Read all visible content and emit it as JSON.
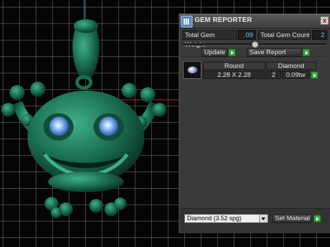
{
  "viewport": {
    "accent_colors": {
      "model": "#1f7a5c",
      "eyes": "#7ab8ff",
      "axis_x": "#b02020",
      "axis_y": "#2aa6c8"
    }
  },
  "panel": {
    "title": "GEM REPORTER",
    "close_label": "x",
    "total_gem_weight_label": "Total Gem Weight",
    "total_gem_weight_value": ".09",
    "total_gem_count_label": "Total Gem Count",
    "total_gem_count_value": "2",
    "update_label": "Update",
    "save_report_label": "Save Report",
    "table": {
      "headers": [
        "Round",
        "Diamond"
      ],
      "row": {
        "size": "2.28 X 2.28",
        "count": "2",
        "weight": "0.09tw"
      }
    },
    "material_select_value": "Diamond      (3.52 spg)",
    "set_material_label": "Set Material"
  }
}
